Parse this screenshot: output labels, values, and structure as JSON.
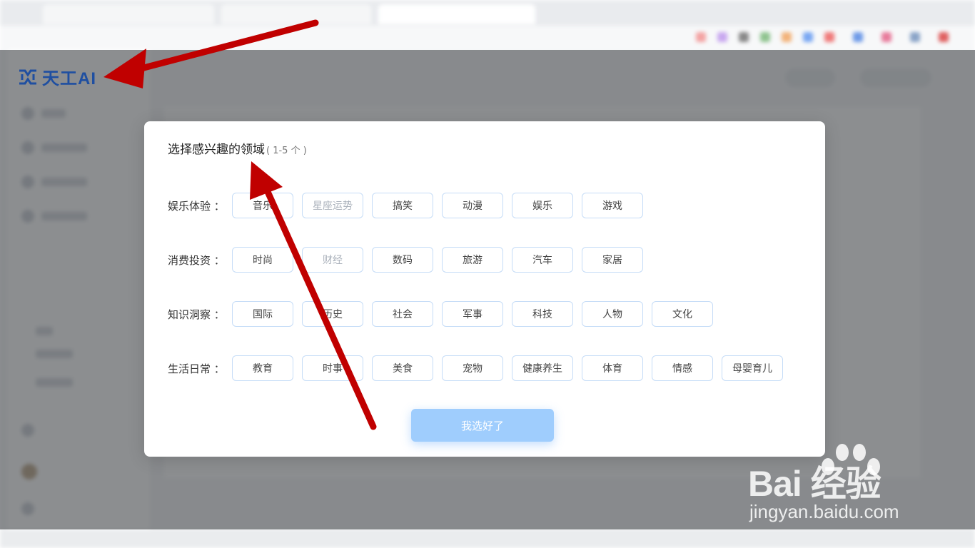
{
  "logo": {
    "text": "天工AI",
    "color": "#1f4fa1"
  },
  "modal": {
    "title": "选择感兴趣的领域",
    "hint": "( 1-5 个 )",
    "confirm_label": "我选好了",
    "confirm_color": "#9fcdfd",
    "chip_border_color": "#c5dcf7",
    "categories": [
      {
        "label": "娱乐体验 ：",
        "chips": [
          "音乐",
          "星座运势",
          "搞笑",
          "动漫",
          "娱乐",
          "游戏"
        ]
      },
      {
        "label": "消费投资 ：",
        "chips": [
          "时尚",
          "财经",
          "数码",
          "旅游",
          "汽车",
          "家居"
        ]
      },
      {
        "label": "知识洞察 ：",
        "chips": [
          "国际",
          "历史",
          "社会",
          "军事",
          "科技",
          "人物",
          "文化"
        ]
      },
      {
        "label": "生活日常 ：",
        "chips": [
          "教育",
          "时事",
          "美食",
          "宠物",
          "健康养生",
          "体育",
          "情感",
          "母婴育儿"
        ]
      }
    ]
  },
  "annotation": {
    "arrow_color": "#c00000"
  },
  "watermark": {
    "brand": "Bai 经验",
    "url": "jingyan.baidu.com"
  }
}
